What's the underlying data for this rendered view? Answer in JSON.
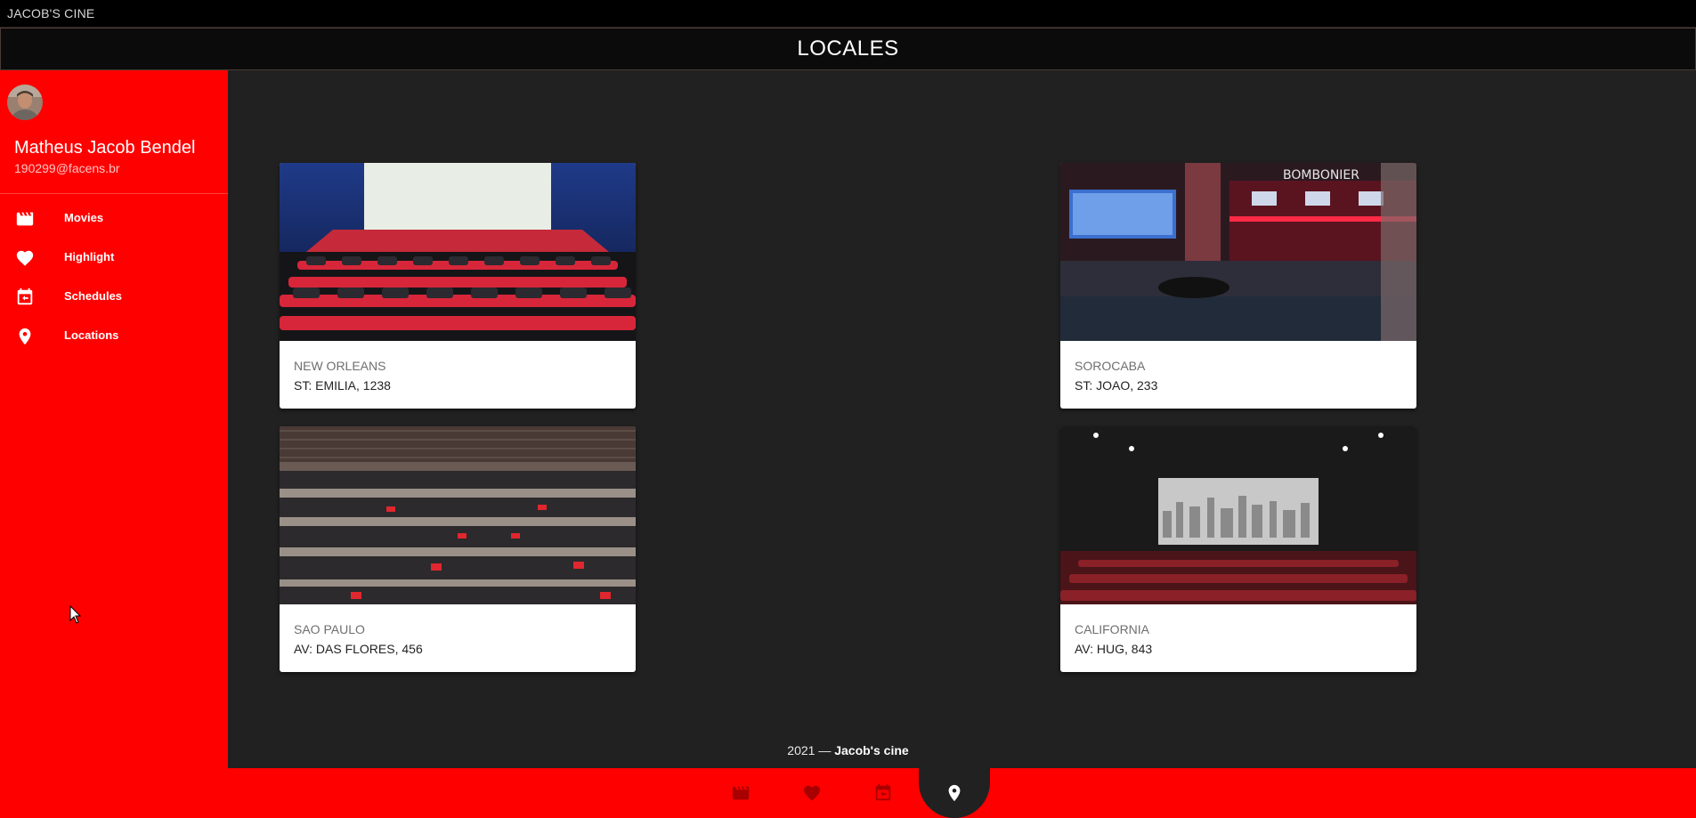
{
  "app": {
    "title": "JACOB'S CINE"
  },
  "header": {
    "title": "LOCALES"
  },
  "sidebar": {
    "user": {
      "name": "Matheus Jacob Bendel",
      "email": "190299@facens.br"
    },
    "items": [
      {
        "label": "Movies",
        "icon": "movie-clapper-icon"
      },
      {
        "label": "Highlight",
        "icon": "heart-icon"
      },
      {
        "label": "Schedules",
        "icon": "calendar-icon"
      },
      {
        "label": "Locations",
        "icon": "location-pin-icon"
      }
    ]
  },
  "locations": [
    {
      "name": "NEW ORLEANS",
      "address": "ST: EMILIA, 1238"
    },
    {
      "name": "SOROCABA",
      "address": "ST: JOAO, 233"
    },
    {
      "name": "SAO PAULO",
      "address": "AV: DAS FLORES, 456"
    },
    {
      "name": "CALIFORNIA",
      "address": "AV: HUG, 843"
    }
  ],
  "footer": {
    "year_prefix": "2021 —",
    "brand": "Jacob's cine"
  },
  "bottom_nav": {
    "items": [
      "movie-clapper-icon",
      "heart-icon",
      "calendar-icon",
      "location-pin-icon"
    ],
    "active": "location-pin-icon"
  },
  "colors": {
    "primary": "#ff0000",
    "background": "#212121",
    "topbar": "#000000"
  }
}
